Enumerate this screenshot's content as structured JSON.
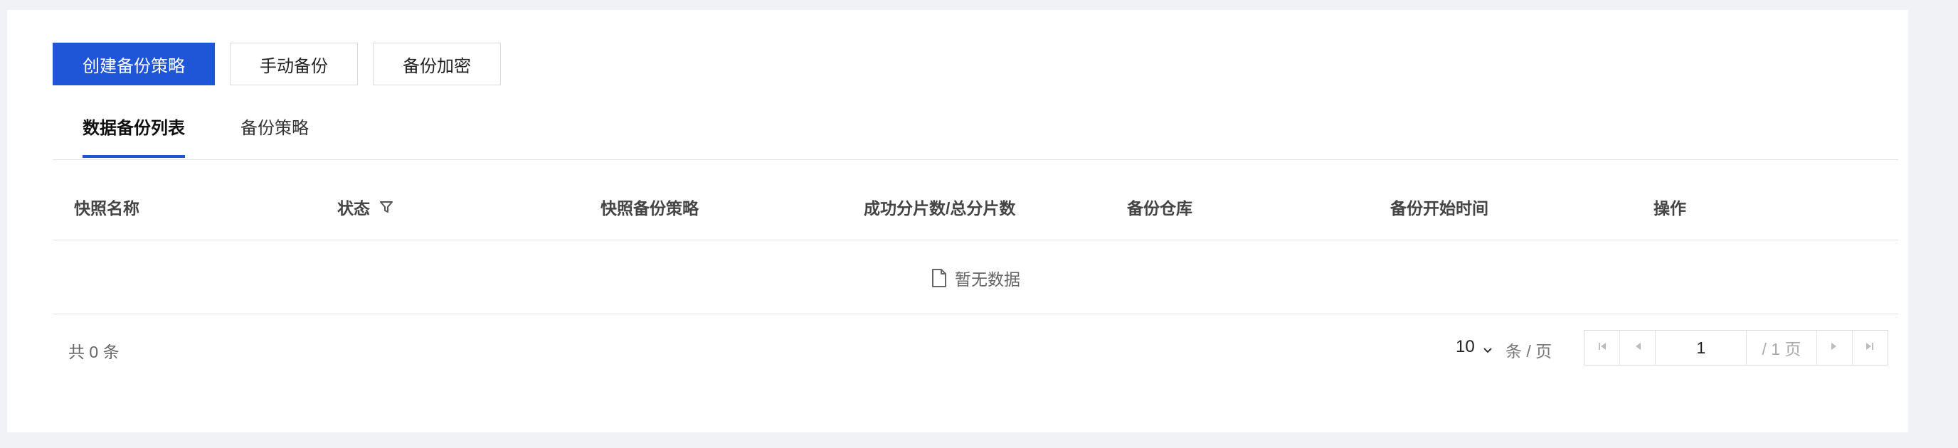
{
  "toolbar": {
    "create_policy": "创建备份策略",
    "manual_backup": "手动备份",
    "backup_encrypt": "备份加密"
  },
  "tabs": [
    {
      "label": "数据备份列表",
      "active": true
    },
    {
      "label": "备份策略",
      "active": false
    }
  ],
  "table": {
    "columns": [
      "快照名称",
      "状态",
      "快照备份策略",
      "成功分片数/总分片数",
      "备份仓库",
      "备份开始时间",
      "操作"
    ],
    "empty_text": "暂无数据"
  },
  "pagination": {
    "total_text": "共 0 条",
    "page_size": "10",
    "per_page_text": "条 / 页",
    "current_page": "1",
    "total_pages_text": "/ 1 页"
  },
  "colors": {
    "primary": "#1f56d8",
    "background": "#f1f2f5"
  },
  "icons": {
    "filter": "filter-icon",
    "empty": "document-icon",
    "page_size": "chevron-down-icon",
    "first": "first-page-icon",
    "prev": "prev-page-icon",
    "next": "next-page-icon",
    "last": "last-page-icon"
  }
}
